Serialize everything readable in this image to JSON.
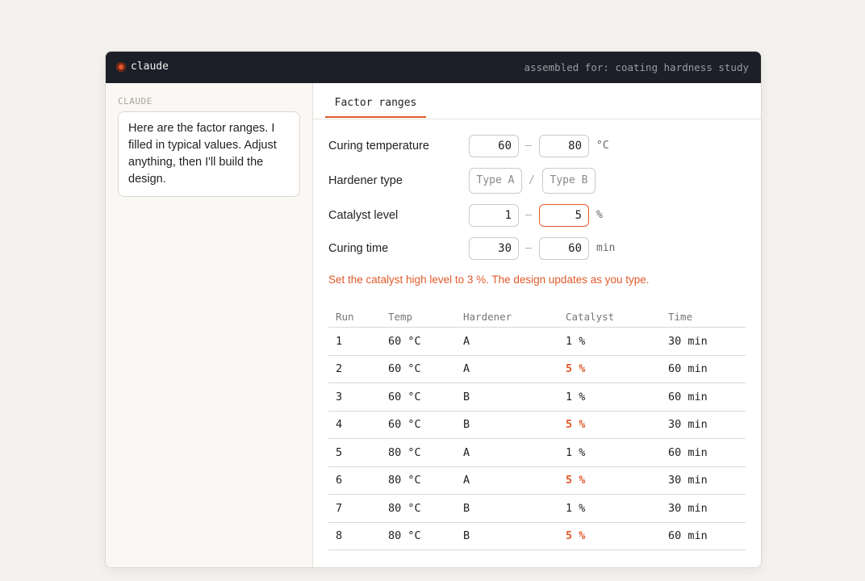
{
  "titlebar": {
    "app_name": "claude",
    "context": "assembled for: coating hardness study"
  },
  "sidebar": {
    "speaker": "CLAUDE",
    "message": "Here are the factor ranges. I filled in typical values. Adjust anything, then I'll build the design."
  },
  "tabs": [
    {
      "label": "Factor ranges",
      "active": true
    }
  ],
  "factors": {
    "temperature": {
      "label": "Curing temperature",
      "low": "60",
      "sep": "–",
      "high": "80",
      "unit": "°C"
    },
    "hardener": {
      "label": "Hardener type",
      "low_placeholder": "Type A",
      "sep": "/",
      "high_placeholder": "Type B"
    },
    "catalyst": {
      "label": "Catalyst level",
      "low": "1",
      "sep": "–",
      "high": "5",
      "unit": "%"
    },
    "time": {
      "label": "Curing time",
      "low": "30",
      "sep": "–",
      "high": "60",
      "unit": "min"
    }
  },
  "status_message": "Set the catalyst high level to 3 %. The design updates as you type.",
  "table": {
    "headers": [
      "Run",
      "Temp",
      "Hardener",
      "Catalyst",
      "Time"
    ],
    "rows": [
      [
        "1",
        "60 °C",
        "A",
        "1 %",
        "30 min"
      ],
      [
        "2",
        "60 °C",
        "A",
        "5 %",
        "60 min"
      ],
      [
        "3",
        "60 °C",
        "B",
        "1 %",
        "60 min"
      ],
      [
        "4",
        "60 °C",
        "B",
        "5 %",
        "30 min"
      ],
      [
        "5",
        "80 °C",
        "A",
        "1 %",
        "60 min"
      ],
      [
        "6",
        "80 °C",
        "A",
        "5 %",
        "30 min"
      ],
      [
        "7",
        "80 °C",
        "B",
        "1 %",
        "30 min"
      ],
      [
        "8",
        "80 °C",
        "B",
        "5 %",
        "60 min"
      ]
    ]
  },
  "colors": {
    "accent": "#e05a2b",
    "titlebar_bg": "#1c1f27",
    "sidebar_bg": "#faf8f4"
  }
}
